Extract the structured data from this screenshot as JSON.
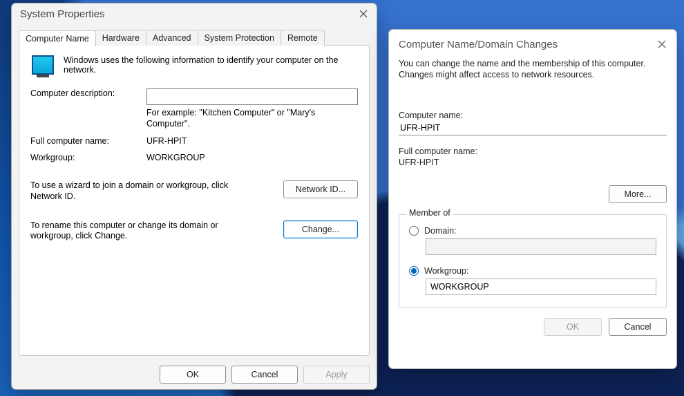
{
  "sysprop": {
    "title": "System Properties",
    "tabs": [
      "Computer Name",
      "Hardware",
      "Advanced",
      "System Protection",
      "Remote"
    ],
    "active_tab": 0,
    "intro": "Windows uses the following information to identify your computer on the network.",
    "desc_label": "Computer description:",
    "desc_value": "",
    "example": "For example: \"Kitchen Computer\" or \"Mary's Computer\".",
    "fullname_label": "Full computer name:",
    "fullname_value": "UFR-HPIT",
    "workgroup_label": "Workgroup:",
    "workgroup_value": "WORKGROUP",
    "wizard_text": "To use a wizard to join a domain or workgroup, click Network ID.",
    "network_id_btn": "Network ID...",
    "change_text": "To rename this computer or change its domain or workgroup, click Change.",
    "change_btn": "Change...",
    "ok_btn": "OK",
    "cancel_btn": "Cancel",
    "apply_btn": "Apply"
  },
  "dom": {
    "title": "Computer Name/Domain Changes",
    "desc": "You can change the name and the membership of this computer. Changes might affect access to network resources.",
    "name_label": "Computer name:",
    "name_value": "UFR-HPIT",
    "full_label": "Full computer name:",
    "full_value": "UFR-HPIT",
    "more_btn": "More...",
    "member_legend": "Member of",
    "domain_label": "Domain:",
    "domain_value": "",
    "workgroup_label": "Workgroup:",
    "workgroup_value": "WORKGROUP",
    "member_selected": "workgroup",
    "ok_btn": "OK",
    "cancel_btn": "Cancel"
  }
}
